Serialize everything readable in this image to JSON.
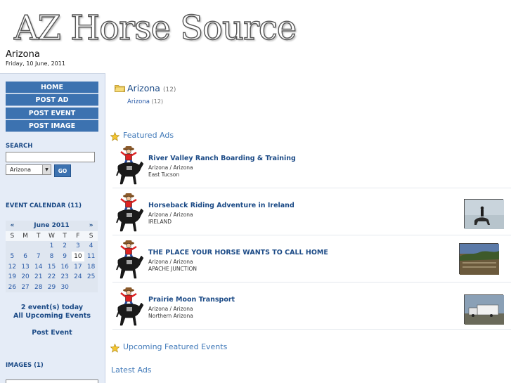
{
  "header": {
    "logo_text": "AZ Horse Source",
    "region": "Arizona",
    "date": "Friday, 10 June, 2011"
  },
  "nav": {
    "items": [
      {
        "label": "HOME"
      },
      {
        "label": "POST AD"
      },
      {
        "label": "POST EVENT"
      },
      {
        "label": "POST IMAGE"
      }
    ]
  },
  "search": {
    "label": "SEARCH",
    "value": "",
    "select_value": "Arizona",
    "go_label": "GO"
  },
  "calendar": {
    "label": "EVENT CALENDAR (11)",
    "prev": "«",
    "month": "June 2011",
    "next": "»",
    "dow": [
      "S",
      "M",
      "T",
      "W",
      "T",
      "F",
      "S"
    ],
    "weeks": [
      [
        "",
        "",
        "",
        "1",
        "2",
        "3",
        "4"
      ],
      [
        "5",
        "6",
        "7",
        "8",
        "9",
        "10",
        "11"
      ],
      [
        "12",
        "13",
        "14",
        "15",
        "16",
        "17",
        "18"
      ],
      [
        "19",
        "20",
        "21",
        "22",
        "23",
        "24",
        "25"
      ],
      [
        "26",
        "27",
        "28",
        "29",
        "30",
        "",
        ""
      ]
    ],
    "today": "10",
    "events_today": "2 event(s) today",
    "all_upcoming": "All Upcoming Events",
    "post_event": "Post Event"
  },
  "images": {
    "label": "IMAGES (1)"
  },
  "main": {
    "category_title": "Arizona",
    "category_count": "(12)",
    "sub_link": "Arizona",
    "sub_count": "(12)",
    "featured_heading": "Featured Ads",
    "upcoming_heading": "Upcoming Featured Events",
    "latest_heading": "Latest Ads",
    "ads": [
      {
        "title": "River Valley Ranch Boarding & Training",
        "location": "Arizona / Arizona",
        "city": "East Tucson"
      },
      {
        "title": "Horseback Riding Adventure in Ireland",
        "location": "Arizona / Arizona",
        "city": "IRELAND"
      },
      {
        "title": "THE PLACE YOUR HORSE WANTS TO CALL HOME",
        "location": "Arizona / Arizona",
        "city": "APACHE JUNCTION"
      },
      {
        "title": "Prairie Moon Transport",
        "location": "Arizona / Arizona",
        "city": "Northern Arizona"
      }
    ]
  },
  "colors": {
    "nav_blue": "#3c72b0",
    "sidebar_bg": "#e5ecf7",
    "link_blue": "#1b4a86",
    "heading_blue": "#3f78b8"
  }
}
